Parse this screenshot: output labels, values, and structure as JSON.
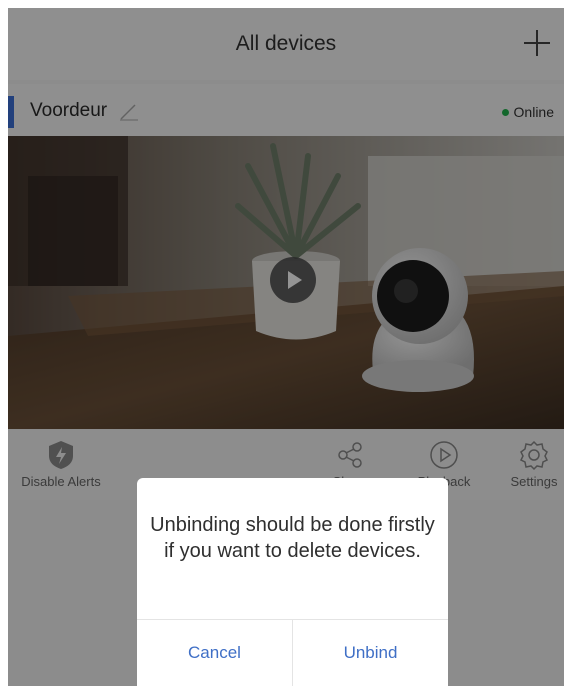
{
  "header": {
    "title": "All devices",
    "add_icon": "plus-icon"
  },
  "device": {
    "name": "Voordeur",
    "edit_icon": "pencil-icon",
    "status": "Online",
    "status_color": "#22b24c",
    "accent_color": "#3b6fd6"
  },
  "preview": {
    "play_icon": "play-icon"
  },
  "actions": [
    {
      "label": "Disable Alerts",
      "icon": "shield-bolt-icon"
    },
    {
      "label": "Share",
      "icon": "share-icon"
    },
    {
      "label": "Playback",
      "icon": "playback-icon"
    },
    {
      "label": "Settings",
      "icon": "settings-gear-icon"
    }
  ],
  "dialog": {
    "message": "Unbinding should be done firstly if you want to delete devices.",
    "cancel_label": "Cancel",
    "confirm_label": "Unbind",
    "button_color": "#3f6fc6"
  }
}
